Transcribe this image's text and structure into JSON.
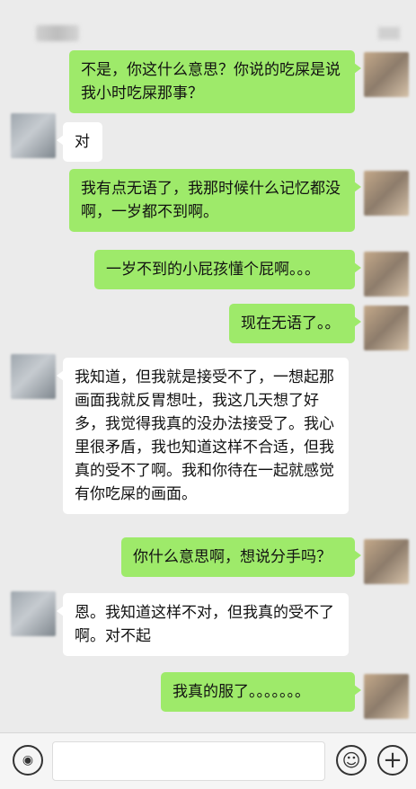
{
  "header": {},
  "messages": [
    {
      "sender": "me",
      "text": "不是，你这什么意思？你说的吃屎是说我小时吃屎那事？"
    },
    {
      "sender": "them",
      "text": "对"
    },
    {
      "sender": "me",
      "text": "我有点无语了，我那时候什么记忆都没啊，一岁都不到啊。"
    },
    {
      "sender": "me",
      "text": "一岁不到的小屁孩懂个屁啊。。。"
    },
    {
      "sender": "me",
      "text": "现在无语了。。"
    },
    {
      "sender": "them",
      "text": "我知道，但我就是接受不了，一想起那画面我就反胃想吐，我这几天想了好多，我觉得我真的没办法接受了。我心里很矛盾，我也知道这样不合适，但我真的受不了啊。我和你待在一起就感觉有你吃屎的画面。"
    },
    {
      "sender": "me",
      "text": "你什么意思啊，想说分手吗？"
    },
    {
      "sender": "them",
      "text": "恩。我知道这样不对，但我真的受不了啊。对不起"
    },
    {
      "sender": "me",
      "text": "我真的服了。。。。。。。"
    }
  ],
  "input_bar": {
    "voice_icon": "voice-icon",
    "emoji_icon": "emoji-icon",
    "plus_icon": "plus-icon",
    "emoji_glyph": "☺",
    "plus_glyph": "+",
    "voice_glyph": "◉",
    "placeholder": ""
  },
  "colors": {
    "background": "#ebebeb",
    "my_bubble": "#9eea6a",
    "their_bubble": "#ffffff"
  }
}
